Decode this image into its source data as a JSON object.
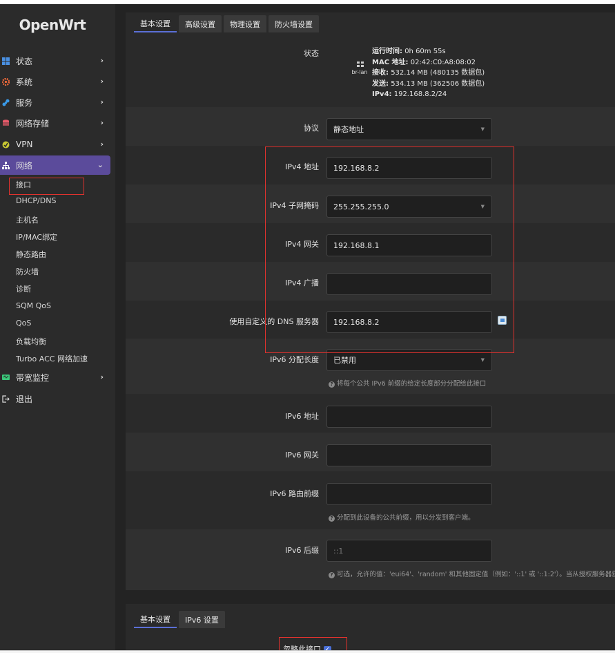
{
  "app": {
    "logo": "OpenWrt"
  },
  "sidebar": {
    "menu": [
      {
        "label": "状态",
        "icon": "dashboard-icon",
        "color": "#4a90e2"
      },
      {
        "label": "系统",
        "icon": "gear-icon",
        "color": "#f06a3a"
      },
      {
        "label": "服务",
        "icon": "puzzle-icon",
        "color": "#3a9ae8"
      },
      {
        "label": "网络存储",
        "icon": "storage-icon",
        "color": "#e85a6a"
      },
      {
        "label": "VPN",
        "icon": "vpn-icon",
        "color": "#c8c832"
      },
      {
        "label": "网络",
        "icon": "network-icon",
        "color": "#ffffff"
      },
      {
        "label": "带宽监控",
        "icon": "monitor-icon",
        "color": "#3ac87a"
      },
      {
        "label": "退出",
        "icon": "logout-icon",
        "color": "#dddddd"
      }
    ],
    "network_sub": [
      "接口",
      "DHCP/DNS",
      "主机名",
      "IP/MAC绑定",
      "静态路由",
      "防火墙",
      "诊断",
      "SQM QoS",
      "QoS",
      "负载均衡",
      "Turbo ACC 网络加速"
    ]
  },
  "tabs_top": [
    "基本设置",
    "高级设置",
    "物理设置",
    "防火墙设置"
  ],
  "status": {
    "label": "状态",
    "device": "br-lan",
    "uptime_key": "运行时间:",
    "uptime": "0h 60m 55s",
    "mac_key": "MAC 地址:",
    "mac": "02:42:C0:A8:08:02",
    "rx_key": "接收:",
    "rx": "532.14 MB (480135 数据包)",
    "tx_key": "发送:",
    "tx": "534.13 MB (362506 数据包)",
    "ipv4_key": "IPv4:",
    "ipv4": "192.168.8.2/24"
  },
  "form": {
    "protocol": {
      "label": "协议",
      "value": "静态地址"
    },
    "ipv4_addr": {
      "label": "IPv4 地址",
      "value": "192.168.8.2"
    },
    "ipv4_mask": {
      "label": "IPv4 子网掩码",
      "value": "255.255.255.0"
    },
    "ipv4_gw": {
      "label": "IPv4 网关",
      "value": "192.168.8.1"
    },
    "ipv4_bcast": {
      "label": "IPv4 广播",
      "value": ""
    },
    "dns": {
      "label": "使用自定义的 DNS 服务器",
      "value": "192.168.8.2"
    },
    "ip6assign": {
      "label": "IPv6 分配长度",
      "value": "已禁用",
      "hint": "将每个公共 IPv6 前缀的给定长度部分分配给此接口"
    },
    "ipv6_addr": {
      "label": "IPv6 地址",
      "value": ""
    },
    "ipv6_gw": {
      "label": "IPv6 网关",
      "value": ""
    },
    "ipv6_prefix": {
      "label": "IPv6 路由前缀",
      "value": "",
      "hint": "分配到此设备的公共前缀，用以分发到客户端。"
    },
    "ipv6_suffix": {
      "label": "IPv6 后缀",
      "placeholder": "::1",
      "hint": "可选，允许的值：'eui64'、'random' 和其他固定值（例如：'::1' 或 '::1:2'）。当从授权服务器获取"
    }
  },
  "tabs_bottom": [
    "基本设置",
    "IPv6 设置"
  ],
  "ignore": {
    "label": "忽略此接口",
    "checked": true
  },
  "colors": {
    "accent": "#5b4b9b",
    "tab_underline": "#5b6fd6",
    "highlight": "#e0322e"
  }
}
